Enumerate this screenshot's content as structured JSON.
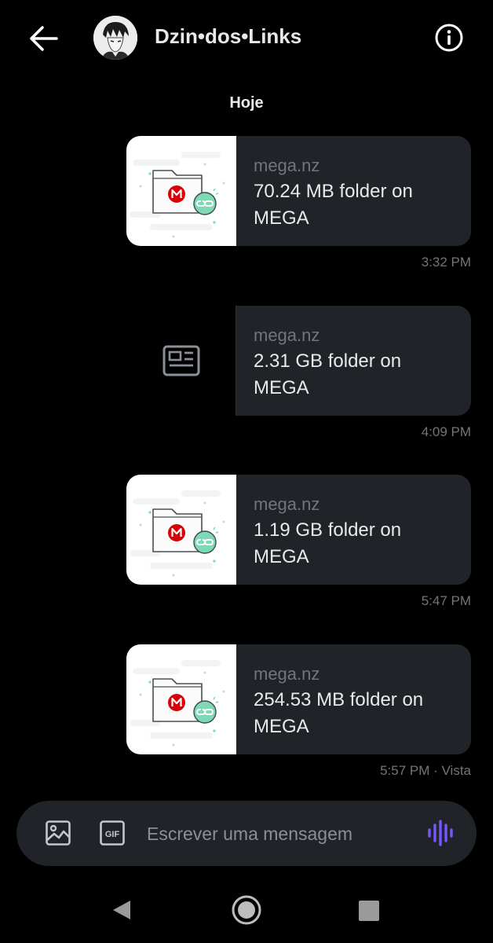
{
  "header": {
    "title": "Dzin•dos•Links",
    "back_icon": "arrow-left-icon",
    "info_icon": "info-icon"
  },
  "conversation": {
    "date_label": "Hoje",
    "messages": [
      {
        "domain": "mega.nz",
        "title": "70.24 MB folder on MEGA",
        "time": "3:32 PM",
        "thumbnail": "mega-folder-link"
      },
      {
        "domain": "mega.nz",
        "title": "2.31 GB folder on MEGA",
        "time": "4:09 PM",
        "thumbnail": "article-placeholder-icon"
      },
      {
        "domain": "mega.nz",
        "title": "1.19 GB folder on MEGA",
        "time": "5:47 PM",
        "thumbnail": "mega-folder-link"
      },
      {
        "domain": "mega.nz",
        "title": "254.53 MB folder on MEGA",
        "time": "5:57 PM · Vista",
        "thumbnail": "mega-folder-link"
      }
    ]
  },
  "composer": {
    "placeholder": "Escrever uma mensagem",
    "gif_label": "GIF",
    "accent_color": "#7856ff"
  },
  "colors": {
    "background": "#000000",
    "card_background": "#202327",
    "mega_red": "#d90007",
    "link_badge_green": "#7fd9b7"
  }
}
